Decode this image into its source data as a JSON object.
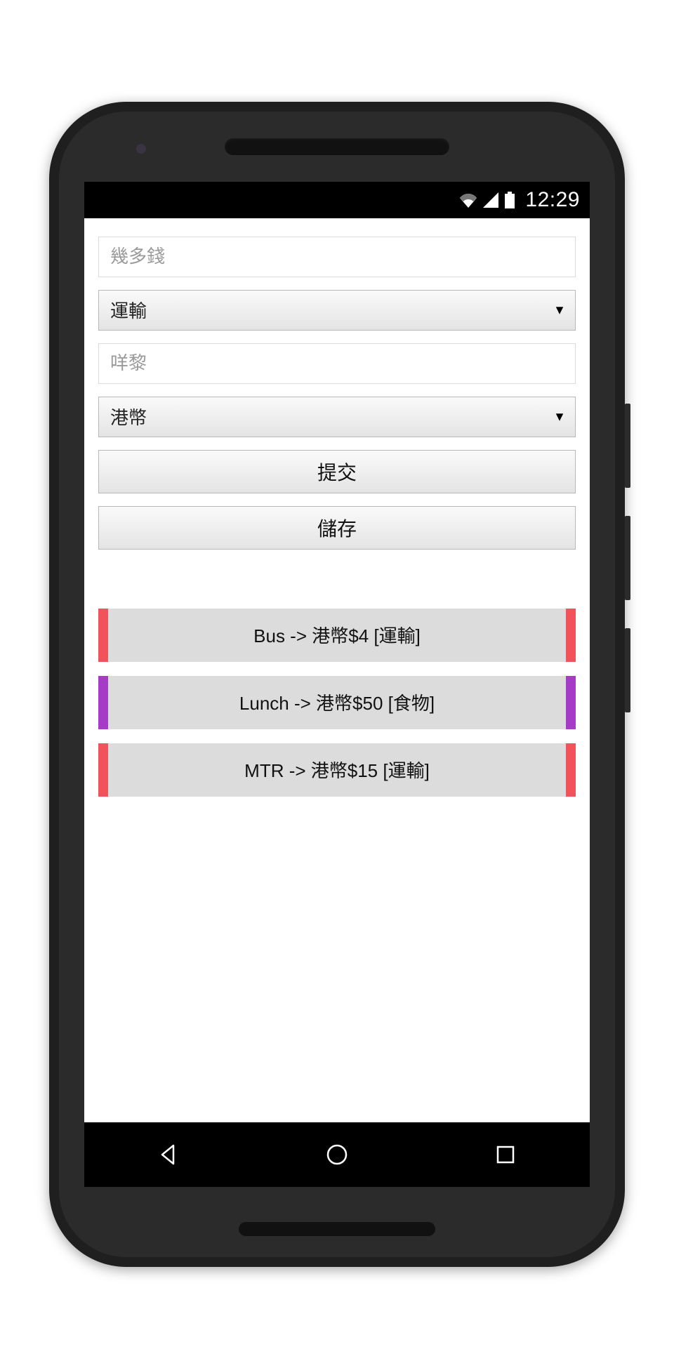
{
  "status": {
    "time": "12:29"
  },
  "form": {
    "amount_placeholder": "幾多錢",
    "amount_value": "",
    "category_selected": "運輸",
    "note_placeholder": "咩黎",
    "note_value": "",
    "currency_selected": "港幣",
    "submit_label": "提交",
    "save_label": "儲存"
  },
  "entries": [
    {
      "text": "Bus -> 港幣$4 [運輸]",
      "stripe": "#f2535a"
    },
    {
      "text": "Lunch -> 港幣$50 [食物]",
      "stripe": "#a53bc7"
    },
    {
      "text": "MTR -> 港幣$15 [運輸]",
      "stripe": "#f2535a"
    }
  ]
}
